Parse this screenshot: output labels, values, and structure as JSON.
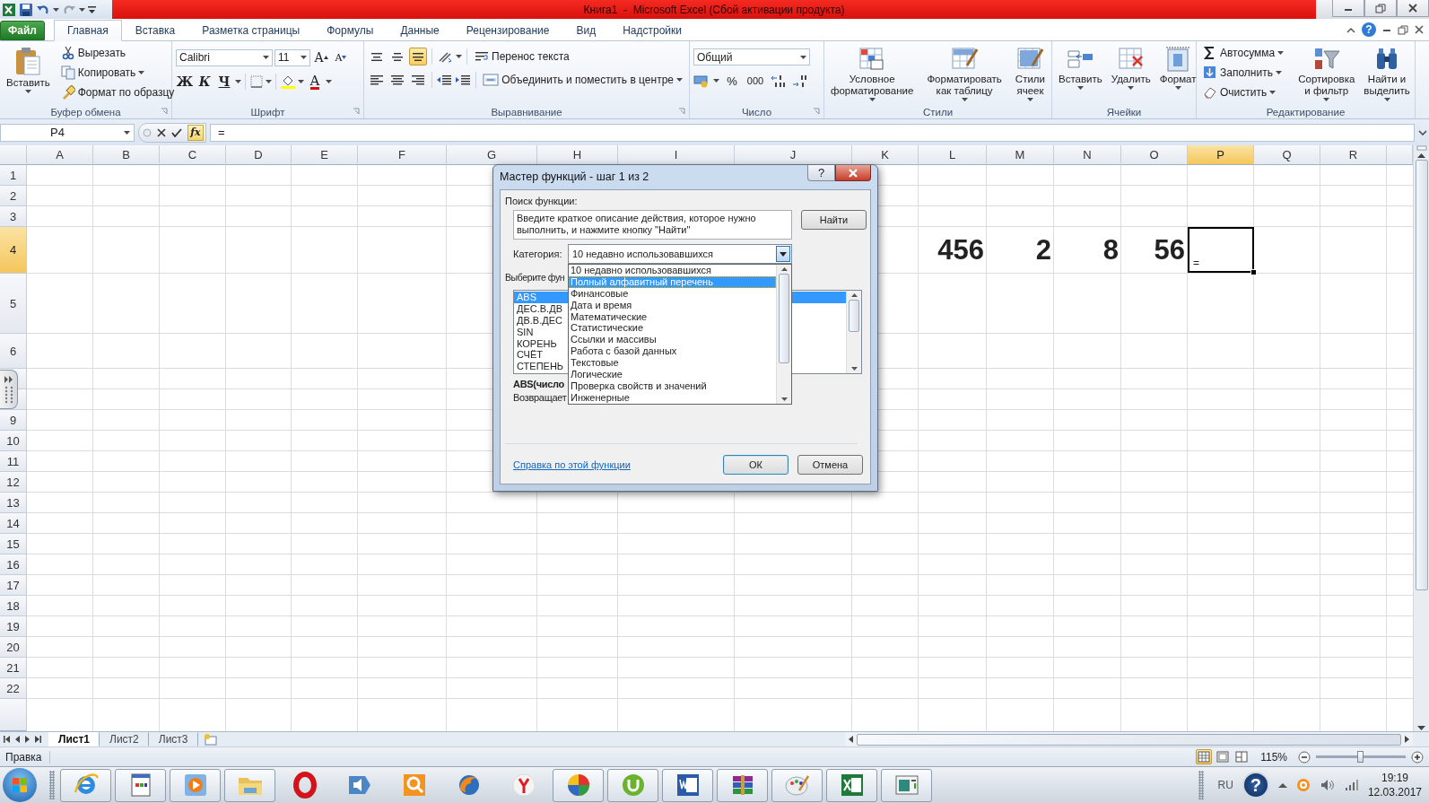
{
  "title_bar": {
    "title": "Книга1  -  Microsoft Excel (Сбой активации продукта)"
  },
  "ribbon_tabs": [
    {
      "label": "Файл",
      "kind": "file",
      "selected": false
    },
    {
      "label": "Главная",
      "kind": "tab",
      "selected": true
    },
    {
      "label": "Вставка",
      "kind": "tab",
      "selected": false
    },
    {
      "label": "Разметка страницы",
      "kind": "tab",
      "selected": false
    },
    {
      "label": "Формулы",
      "kind": "tab",
      "selected": false
    },
    {
      "label": "Данные",
      "kind": "tab",
      "selected": false
    },
    {
      "label": "Рецензирование",
      "kind": "tab",
      "selected": false
    },
    {
      "label": "Вид",
      "kind": "tab",
      "selected": false
    },
    {
      "label": "Надстройки",
      "kind": "tab",
      "selected": false
    }
  ],
  "ribbon_help": "?",
  "ribbon_groups": [
    {
      "kind": "clipboard",
      "label": "Буфер обмена",
      "paste": "Вставить",
      "commands": [
        "Вырезать",
        "Копировать",
        "Формат по образцу"
      ]
    },
    {
      "kind": "font",
      "label": "Шрифт",
      "font_name": "Calibri",
      "font_size": "11",
      "grow": "A",
      "shrink": "A",
      "styles": [
        "Ж",
        "К",
        "Ч"
      ],
      "font_color": "A"
    },
    {
      "kind": "alignment",
      "label": "Выравнивание",
      "vertical_align": [
        {
          "selected": false
        },
        {
          "selected": false
        },
        {
          "selected": true
        }
      ],
      "wrap": "Перенос текста",
      "merge": "Объединить и поместить в центре"
    },
    {
      "kind": "number",
      "label": "Число",
      "format": "Общий",
      "percent": "%",
      "thousands": "000"
    },
    {
      "kind": "styles",
      "label": "Стили",
      "buttons": [
        "Условное\nформатирование",
        "Форматировать\nкак таблицу",
        "Стили\nячеек"
      ]
    },
    {
      "kind": "cells",
      "label": "Ячейки",
      "buttons": [
        "Вставить",
        "Удалить",
        "Формат"
      ]
    },
    {
      "kind": "editing",
      "label": "Редактирование",
      "commands": [
        "Автосумма",
        "Заполнить",
        "Очистить"
      ],
      "buttons": [
        "Сортировка\nи фильтр",
        "Найти и\nвыделить"
      ]
    }
  ],
  "formula_bar": {
    "name_box": "P4",
    "function_button": "fx",
    "formula": "="
  },
  "sheet": {
    "columns": [
      {
        "label": "A"
      },
      {
        "label": "B"
      },
      {
        "label": "C"
      },
      {
        "label": "D"
      },
      {
        "label": "E"
      },
      {
        "label": "F"
      },
      {
        "label": "G"
      },
      {
        "label": "H"
      },
      {
        "label": "I"
      },
      {
        "label": "J"
      },
      {
        "label": "K"
      },
      {
        "label": "L"
      },
      {
        "label": "M"
      },
      {
        "label": "N"
      },
      {
        "label": "O"
      },
      {
        "label": "P"
      },
      {
        "label": "Q"
      },
      {
        "label": "R"
      }
    ],
    "rows": [
      {
        "label": "1"
      },
      {
        "label": "2"
      },
      {
        "label": "3"
      },
      {
        "label": "4",
        "cells": [
          {
            "value": "456",
            "selected": false
          },
          {
            "value": "2",
            "selected": false
          },
          {
            "value": "8",
            "selected": false
          },
          {
            "value": "56",
            "selected": false
          },
          {
            "value": "=",
            "selected": true
          }
        ]
      },
      {
        "label": "5"
      },
      {
        "label": "6"
      },
      {},
      {},
      {
        "label": "9"
      },
      {
        "label": "10"
      },
      {
        "label": "11"
      },
      {
        "label": "12"
      },
      {
        "label": "13"
      },
      {
        "label": "14"
      },
      {
        "label": "15"
      },
      {
        "label": "16"
      },
      {
        "label": "17"
      },
      {
        "label": "18"
      },
      {
        "label": "19"
      },
      {
        "label": "20"
      },
      {
        "label": "21"
      },
      {
        "label": "22"
      }
    ]
  },
  "dialog": {
    "title": "Мастер функций - шаг 1 из 2",
    "help": "?",
    "search_label": "Поиск функции:",
    "search_value": "Введите краткое описание действия, которое нужно выполнить, и нажмите кнопку \"Найти\"",
    "find_button": "Найти",
    "category_label": "Категория:",
    "category_value": "10 недавно использовавшихся",
    "category_options": [
      {
        "label": "10 недавно использовавшихся",
        "selected": false
      },
      {
        "label": "Полный алфавитный перечень",
        "selected": true
      },
      {
        "label": "Финансовые",
        "selected": false
      },
      {
        "label": "Дата и время",
        "selected": false
      },
      {
        "label": "Математические",
        "selected": false
      },
      {
        "label": "Статистические",
        "selected": false
      },
      {
        "label": "Ссылки и массивы",
        "selected": false
      },
      {
        "label": "Работа с базой данных",
        "selected": false
      },
      {
        "label": "Текстовые",
        "selected": false
      },
      {
        "label": "Логические",
        "selected": false
      },
      {
        "label": "Проверка свойств и значений",
        "selected": false
      },
      {
        "label": "Инженерные",
        "selected": false
      }
    ],
    "select_label": "Выберите фун",
    "functions": [
      {
        "label": "ABS",
        "selected": true
      },
      {
        "label": "ДЕС.В.ДВ",
        "selected": false
      },
      {
        "label": "ДВ.В.ДЕС",
        "selected": false
      },
      {
        "label": "SIN",
        "selected": false
      },
      {
        "label": "КОРЕНЬ",
        "selected": false
      },
      {
        "label": "СЧЁТ",
        "selected": false
      },
      {
        "label": "СТЕПЕНЬ",
        "selected": false
      }
    ],
    "signature": "ABS(число",
    "description": "Возвращает",
    "help_link": "Справка по этой функции",
    "ok": "ОК",
    "cancel": "Отмена"
  },
  "sheet_tabs": [
    {
      "label": "Лист1",
      "selected": true
    },
    {
      "label": "Лист2",
      "selected": false
    },
    {
      "label": "Лист3",
      "selected": false
    }
  ],
  "status_bar": {
    "mode": "Правка",
    "views": [
      {
        "selected": true
      },
      {
        "selected": false
      },
      {
        "selected": false
      }
    ],
    "zoom": "115%",
    "zoom_slider": {
      "level": 0.5
    }
  },
  "taskbar": {
    "apps": [
      {
        "running": true
      },
      {
        "running": true
      },
      {
        "running": true
      },
      {
        "running": true
      },
      {
        "running": false
      },
      {
        "running": false
      },
      {
        "running": false
      },
      {
        "running": false
      },
      {
        "running": false
      },
      {
        "running": true
      },
      {
        "running": true
      },
      {
        "running": true
      },
      {
        "running": true
      },
      {
        "running": true
      },
      {
        "running": true
      },
      {
        "running": true
      }
    ],
    "language": "RU",
    "help": "?",
    "time": "19:19",
    "date": "12.03.2017"
  }
}
